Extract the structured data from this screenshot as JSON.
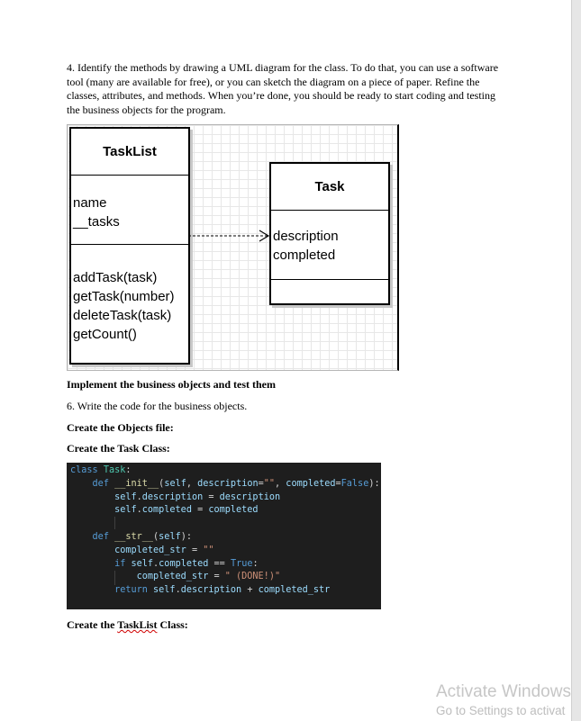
{
  "step4": "4. Identify the methods by drawing a UML diagram for the class. To do that, you can use a software tool (many are available for free), or you can sketch the diagram on a piece of paper. Refine the classes, attributes, and methods. When you’re done, you should be ready to start coding and testing the business objects for the program.",
  "uml": {
    "tasklist": {
      "name": "TaskList",
      "attributes": [
        "name",
        "__tasks"
      ],
      "methods": [
        "addTask(task)",
        "getTask(number)",
        "deleteTask(task)",
        "getCount()"
      ]
    },
    "task": {
      "name": "Task",
      "attributes": [
        "description",
        "completed"
      ]
    }
  },
  "heading_implement": "Implement the business objects and test them",
  "step6": "6. Write the code for the business objects.",
  "heading_objects_file": "Create the Objects file:",
  "heading_task_class": "Create the Task Class:",
  "code_lines": [
    "class Task:",
    "    def __init__(self, description=\"\", completed=False):",
    "        self.description = description",
    "        self.completed = completed",
    "",
    "    def __str__(self):",
    "        completed_str = \"\"",
    "        if self.completed == True:",
    "            completed_str = \" (DONE!)\"",
    "        return self.description + completed_str"
  ],
  "heading_tasklist_prefix": "Create the ",
  "heading_tasklist_word": "TaskList",
  "heading_tasklist_suffix": " Class:",
  "watermark": {
    "line1": "Activate Windows",
    "line2": "Go to Settings to activat"
  },
  "colors": {
    "code_bg": "#1e1e1e",
    "keyword": "#569cd6",
    "function": "#dcdcaa",
    "class_name": "#4ec9b0",
    "string": "#ce9178",
    "variable": "#9cdcfe"
  }
}
